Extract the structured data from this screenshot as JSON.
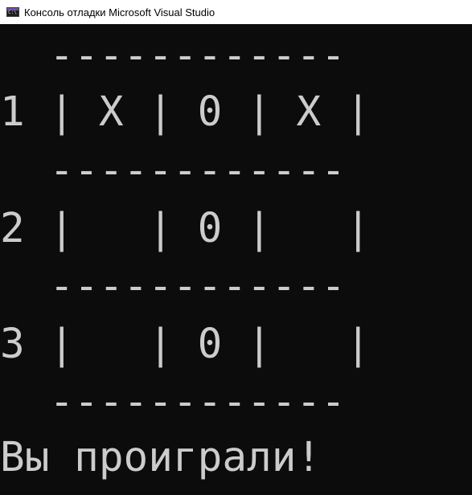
{
  "window": {
    "title": "Консоль отладки Microsoft Visual Studio",
    "icon": "console-app-icon"
  },
  "console": {
    "colors": {
      "background": "#0c0c0c",
      "text": "#cccccc"
    },
    "lines": [
      "  ------------",
      "1 | X | 0 | X |",
      "  ------------",
      "2 |   | 0 |   |",
      "  ------------",
      "3 |   | 0 |   |",
      "  ------------",
      "Вы проиграли!"
    ]
  }
}
